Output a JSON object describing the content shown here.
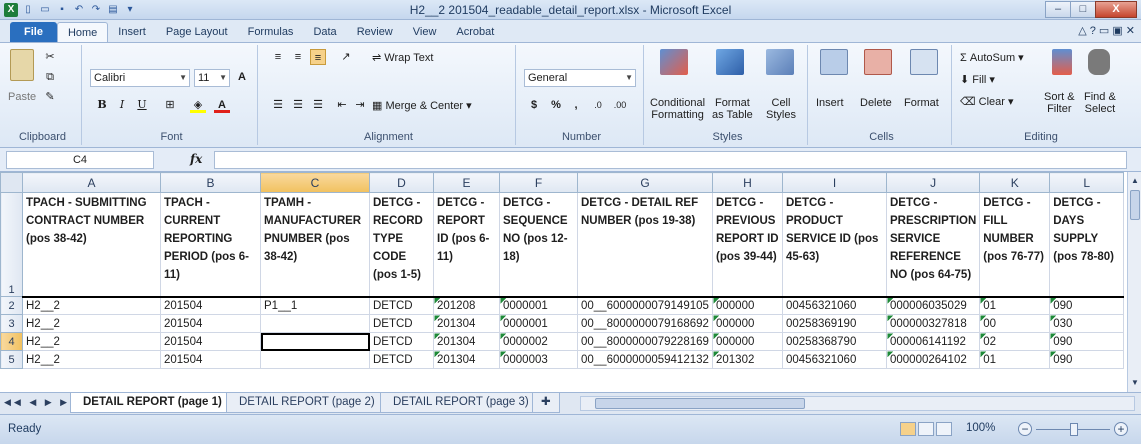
{
  "window": {
    "title": "H2__2 201504_readable_detail_report.xlsx - Microsoft Excel",
    "controls": [
      "–",
      "□",
      "X"
    ]
  },
  "ribbon_tabs": [
    "File",
    "Home",
    "Insert",
    "Page Layout",
    "Formulas",
    "Data",
    "Review",
    "View",
    "Acrobat"
  ],
  "ribbon": {
    "clipboard": {
      "label": "Clipboard",
      "paste": "Paste"
    },
    "font": {
      "label": "Font",
      "name": "Calibri",
      "size": "11",
      "bold": "B",
      "italic": "I",
      "underline": "U"
    },
    "alignment": {
      "label": "Alignment",
      "wrap": "Wrap Text",
      "merge": "Merge & Center"
    },
    "number": {
      "label": "Number",
      "format": "General",
      "currency": "$",
      "percent": "%",
      "comma": ","
    },
    "styles": {
      "label": "Styles",
      "conditional": "Conditional\nFormatting",
      "format_table": "Format\nas Table",
      "cell_styles": "Cell\nStyles"
    },
    "cells": {
      "label": "Cells",
      "insert": "Insert",
      "delete": "Delete",
      "format": "Format"
    },
    "editing": {
      "label": "Editing",
      "autosum": "AutoSum",
      "fill": "Fill",
      "clear": "Clear",
      "sort": "Sort &\nFilter",
      "find": "Find &\nSelect"
    }
  },
  "formula_bar": {
    "name_box": "C4",
    "fx": "fx",
    "value": ""
  },
  "sheet": {
    "columns": [
      "A",
      "B",
      "C",
      "D",
      "E",
      "F",
      "G",
      "H",
      "I",
      "J",
      "K",
      "L"
    ],
    "selected_column": "C",
    "selected_row": "4",
    "headers": [
      "TPACH - SUBMITTING CONTRACT NUMBER (pos 38-42)",
      "TPACH - CURRENT REPORTING PERIOD (pos 6-11)",
      "TPAMH - MANUFACTURER PNUMBER (pos 38-42)",
      "DETCG - RECORD TYPE CODE (pos 1-5)",
      "DETCG - REPORT ID (pos 6-11)",
      "DETCG - SEQUENCE NO (pos 12-18)",
      "DETCG - DETAIL REF NUMBER (pos 19-38)",
      "DETCG - PREVIOUS REPORT ID (pos 39-44)",
      "DETCG - PRODUCT SERVICE ID (pos 45-63)",
      "DETCG - PRESCRIPTION SERVICE REFERENCE NO (pos 64-75)",
      "DETCG - FILL NUMBER (pos 76-77)",
      "DETCG - DAYS SUPPLY (pos 78-80)"
    ],
    "rows": [
      {
        "num": "2",
        "cells": [
          "H2__2",
          "201504",
          "P1__1",
          "DETCD",
          "201208",
          "0000001",
          "00__6000000079149105",
          "000000",
          "00456321060",
          "000006035029",
          "01",
          "090"
        ]
      },
      {
        "num": "3",
        "cells": [
          "H2__2",
          "201504",
          "",
          "DETCD",
          "201304",
          "0000001",
          "00__8000000079168692",
          "000000",
          "00258369190",
          "000000327818",
          "00",
          "030"
        ]
      },
      {
        "num": "4",
        "cells": [
          "H2__2",
          "201504",
          "",
          "DETCD",
          "201304",
          "0000002",
          "00__8000000079228169",
          "000000",
          "00258368790",
          "000006141192",
          "02",
          "090"
        ]
      },
      {
        "num": "5",
        "cells": [
          "H2__2",
          "201504",
          "",
          "DETCD",
          "201304",
          "0000003",
          "00__6000000059412132",
          "201302",
          "00456321060",
          "000000264102",
          "01",
          "090"
        ]
      }
    ],
    "header_row_num": "1"
  },
  "sheet_tabs": [
    "DETAIL REPORT (page 1)",
    "DETAIL REPORT (page 2)",
    "DETAIL REPORT (page 3)"
  ],
  "active_sheet_tab": 0,
  "status": {
    "text": "Ready",
    "zoom": "100%"
  }
}
